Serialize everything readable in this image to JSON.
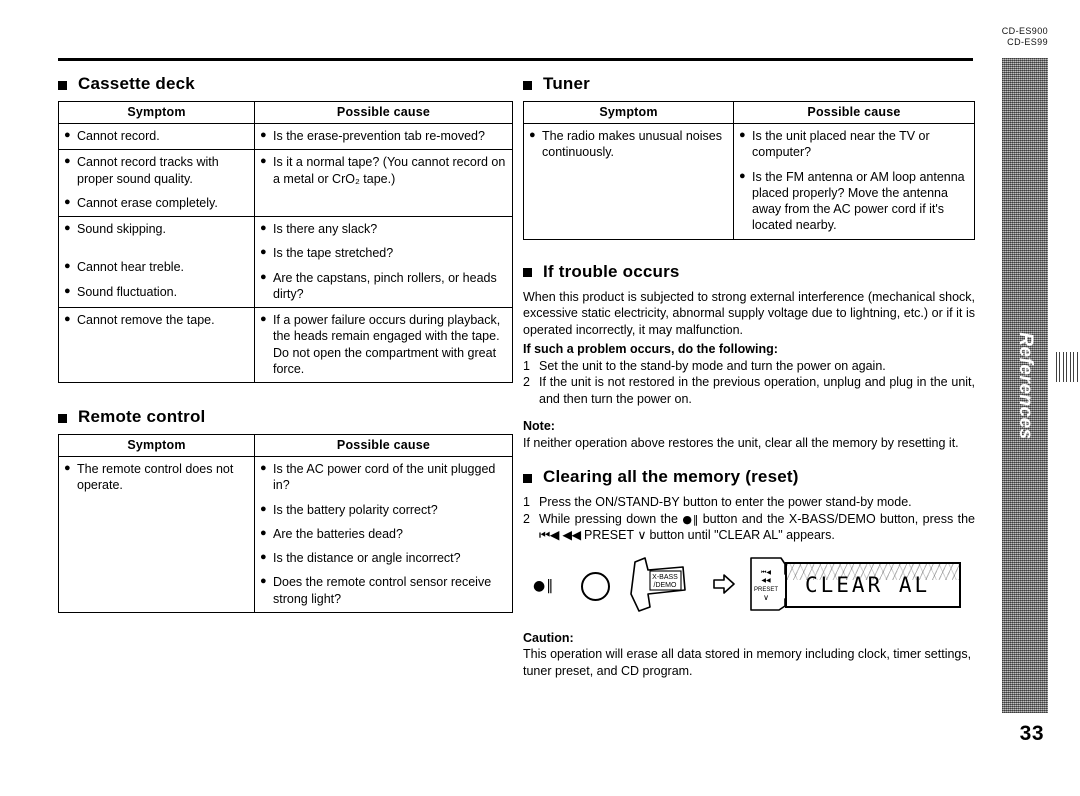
{
  "header": {
    "model_primary": "CD-ES900",
    "model_secondary": "CD-ES99"
  },
  "side_tab": {
    "label": "References",
    "page_number": "33"
  },
  "table_headers": {
    "symptom": "Symptom",
    "possible_cause": "Possible cause"
  },
  "cassette_deck": {
    "heading": "Cassette deck",
    "rows": [
      {
        "symptoms": [
          "Cannot record."
        ],
        "causes": [
          "Is the erase-prevention tab re-moved?"
        ]
      },
      {
        "symptoms": [
          "Cannot record tracks with proper sound quality.",
          "Cannot erase completely."
        ],
        "causes": [
          "Is it a normal tape? (You cannot record on a metal or CrO₂ tape.)"
        ]
      },
      {
        "symptoms": [
          "Sound skipping.",
          "Cannot hear treble.",
          "Sound fluctuation."
        ],
        "causes": [
          "Is there any slack?",
          "Is the tape stretched?",
          "Are the capstans, pinch rollers, or heads dirty?"
        ]
      },
      {
        "symptoms": [
          "Cannot remove the tape."
        ],
        "causes": [
          "If a power failure occurs during playback, the heads remain engaged with the tape. Do not open the compartment with great force."
        ]
      }
    ]
  },
  "remote_control": {
    "heading": "Remote control",
    "rows": [
      {
        "symptoms": [
          "The remote control does not operate."
        ],
        "causes": [
          "Is the AC power cord of the unit plugged in?",
          "Is the battery polarity correct?",
          "Are the batteries dead?",
          "Is the distance or angle incorrect?",
          "Does the remote control sensor receive strong light?"
        ]
      }
    ]
  },
  "tuner": {
    "heading": "Tuner",
    "rows": [
      {
        "symptoms": [
          "The radio makes unusual noises continuously."
        ],
        "causes": [
          "Is the unit placed near the TV or computer?",
          "Is the FM antenna or AM loop antenna placed properly? Move the antenna away from the AC power cord if it's located nearby."
        ]
      }
    ]
  },
  "if_trouble_occurs": {
    "heading": "If trouble occurs",
    "intro": "When this product is subjected to strong external interference (mechanical shock, excessive static electricity, abnormal supply voltage due to lightning, etc.) or if it is operated incorrectly, it may malfunction.",
    "lead": "If such a problem occurs, do the following:",
    "steps": [
      {
        "num": "1",
        "text": "Set the unit to the stand-by mode and turn the power on again."
      },
      {
        "num": "2",
        "text": "If the unit is not restored in the previous operation, unplug and plug in the unit, and then turn the power on."
      }
    ],
    "note_label": "Note:",
    "note_text": "If neither operation above restores the unit, clear all the memory by resetting it."
  },
  "clearing_memory": {
    "heading": "Clearing all the memory (reset)",
    "step1_num": "1",
    "step1_text": "Press the ON/STAND-BY button to enter the power stand-by mode.",
    "step2_num": "2",
    "step2_part1": "While pressing down the ",
    "step2_sym1": "●‖",
    "step2_part2": " button and the X-BASS/DEMO button, press the ",
    "step2_sym2": "⏮◀ ◀◀",
    "step2_part3": " PRESET ",
    "step2_sym3": "∨",
    "step2_part4": " button until \"CLEAR AL\" appears.",
    "illustration": {
      "recpause_symbol": "●‖",
      "xbass_label_line1": "X-BASS",
      "xbass_label_line2": "/DEMO",
      "preset_label_line1": "⏮◀",
      "preset_label_line2": "◀◀",
      "preset_label_line3": "PRESET",
      "preset_label_line4": "∨",
      "lcd_text": "CLEAR AL"
    },
    "caution_label": "Caution:",
    "caution_text": "This operation will erase all data stored in memory including clock, timer settings, tuner preset, and CD program."
  }
}
